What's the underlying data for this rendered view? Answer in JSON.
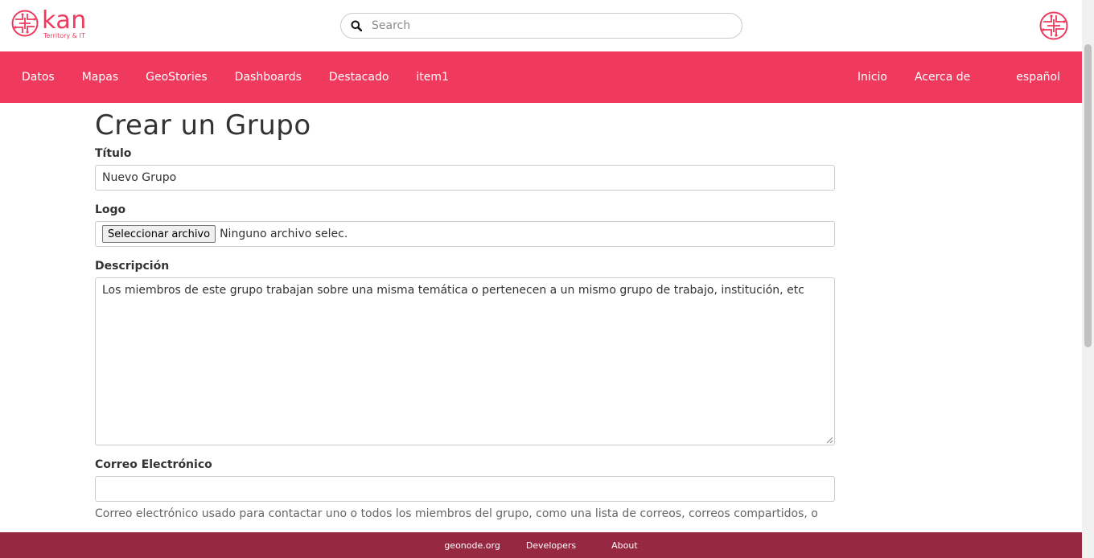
{
  "header": {
    "brand_name": "kan",
    "brand_subtitle": "Territory & IT",
    "search_placeholder": "Search"
  },
  "nav": {
    "left": [
      "Datos",
      "Mapas",
      "GeoStories",
      "Dashboards",
      "Destacado",
      "item1"
    ],
    "right": [
      "Inicio",
      "Acerca de",
      "español"
    ]
  },
  "form": {
    "title": "Crear un Grupo",
    "title_label": "Título",
    "title_value": "Nuevo Grupo",
    "logo_label": "Logo",
    "file_button": "Seleccionar archivo",
    "file_status": "Ninguno archivo selec.",
    "description_label": "Descripción",
    "description_value": "Los miembros de este grupo trabajan sobre una misma temática o pertenecen a un mismo grupo de trabajo, institución, etc",
    "email_label": "Correo Electrónico",
    "email_value": "",
    "email_help": "Correo electrónico usado para contactar uno o todos los miembros del grupo, como una lista de correos, correos compartidos, o"
  },
  "footer": {
    "links": [
      "geonode.org",
      "Developers",
      "About"
    ]
  },
  "colors": {
    "brand": "#ef3a5d",
    "footer": "#962842"
  }
}
